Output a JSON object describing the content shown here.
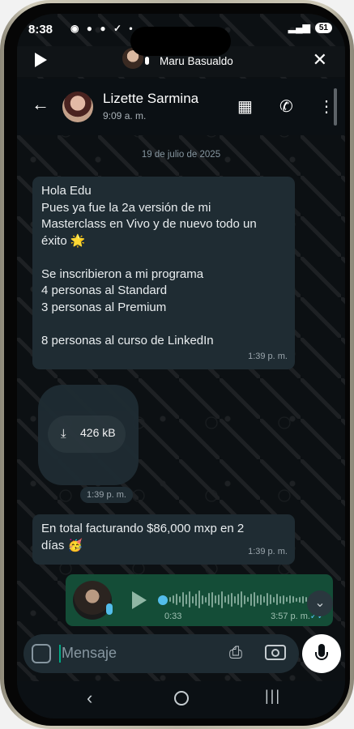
{
  "status_bar": {
    "time": "8:38",
    "left_icons": "◉ ● ● ✓ •",
    "battery": "51"
  },
  "call_banner": {
    "caller_name": "Maru Basualdo",
    "icons": [
      "play-icon",
      "mic-icon",
      "close-icon"
    ]
  },
  "chat_header": {
    "contact_name": "Lizette Sarmina",
    "last_seen": "9:09 a. m.",
    "icons": [
      "back-arrow-icon",
      "store-icon",
      "add-call-icon",
      "more-icon"
    ]
  },
  "messages": {
    "date_chip": "19 de julio de 2025",
    "msg1": {
      "text": "Hola Edu\nPues ya fue la 2a versión de mi\nMasterclass en Vivo y de nuevo todo un\néxito 🌟\n\nSe inscribieron a mi programa\n4 personas al Standard\n3 personas al Premium\n\n8 personas al curso de LinkedIn",
      "time": "1:39 p. m."
    },
    "doc": {
      "size": "426 kB",
      "time": "1:39 p. m."
    },
    "msg2": {
      "text": "En total facturando $86,000 mxp en 2\ndías 🥳",
      "time": "1:39 p. m."
    },
    "voice": {
      "duration": "0:33",
      "time": "3:57 p. m.",
      "ticks": "✓✓",
      "status_color": "#53bdeb"
    }
  },
  "composer": {
    "placeholder": "Mensaje"
  },
  "colors": {
    "incoming_bubble": "#1f2c33",
    "outgoing_bubble": "#144d37",
    "accent": "#00a884"
  }
}
